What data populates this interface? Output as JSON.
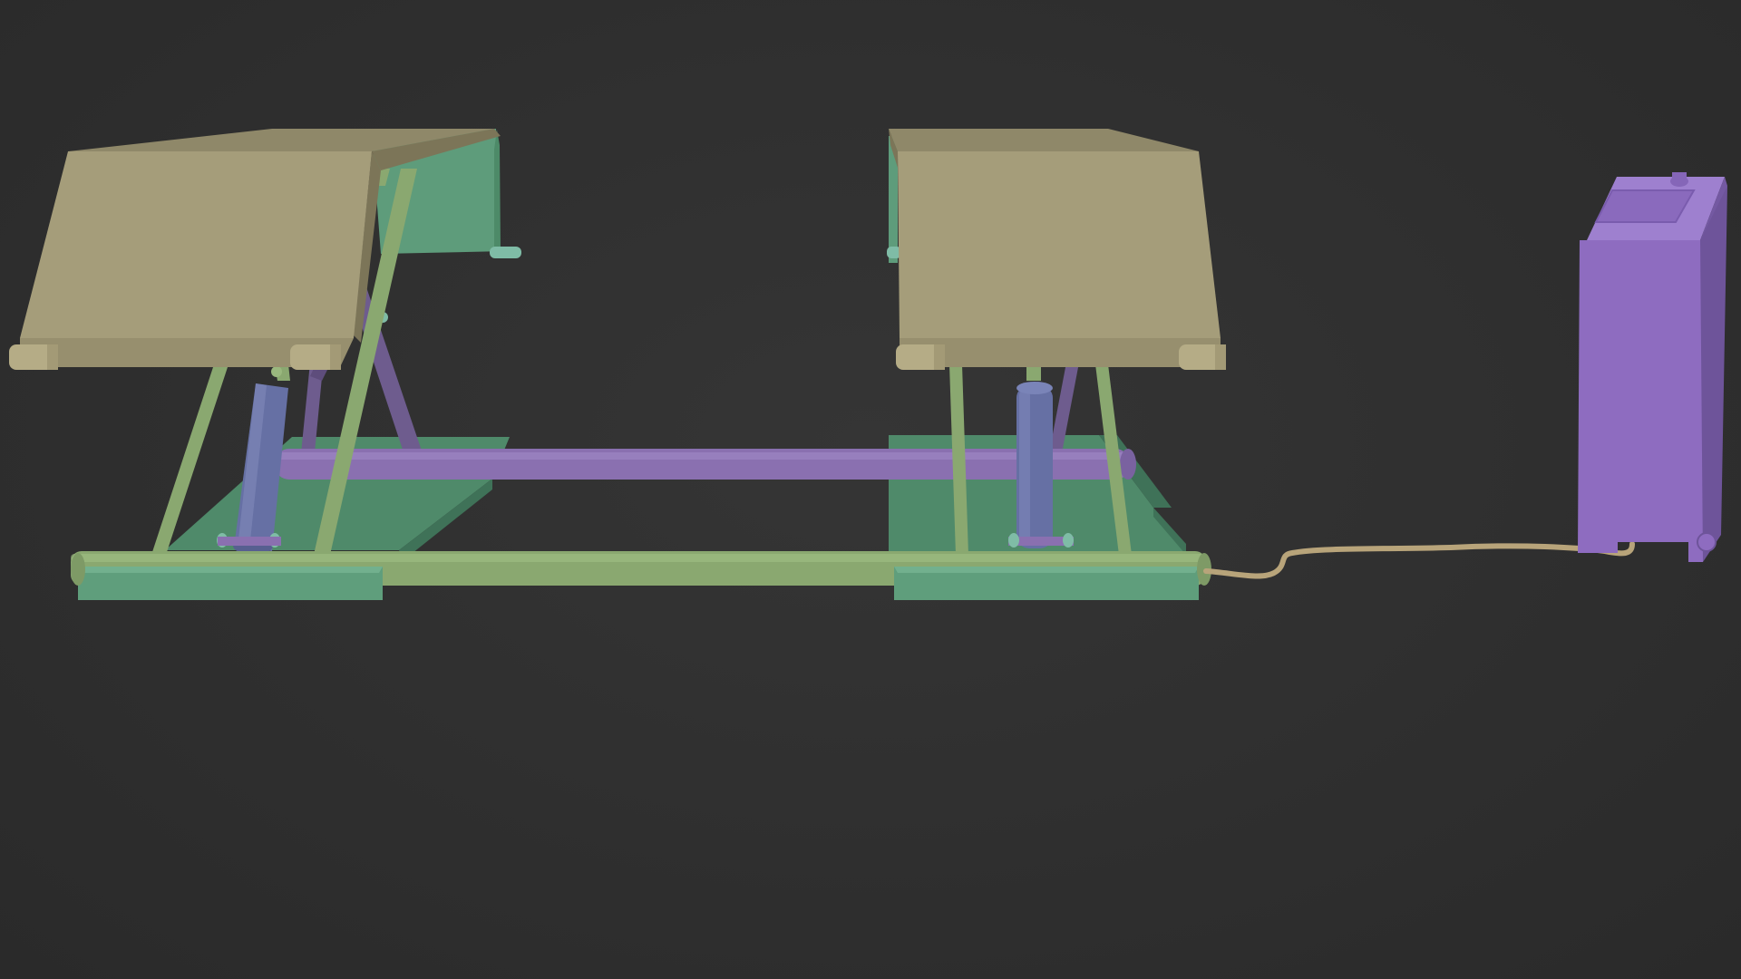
{
  "viewport": {
    "background": "#2e2e2e",
    "shading": "solid"
  },
  "model": {
    "parts": [
      {
        "name": "platform-left",
        "color": "#a59d7a"
      },
      {
        "name": "platform-right",
        "color": "#a59d7a"
      },
      {
        "name": "scissor-arms",
        "color": "#8aa870"
      },
      {
        "name": "base-plates",
        "color": "#5f9e7c"
      },
      {
        "name": "hydraulic-cylinders",
        "color": "#6670a4"
      },
      {
        "name": "cross-bar",
        "color": "#8a70b0"
      },
      {
        "name": "hose",
        "color": "#b8a47a"
      },
      {
        "name": "control-unit",
        "color": "#8e6cc0"
      }
    ]
  }
}
